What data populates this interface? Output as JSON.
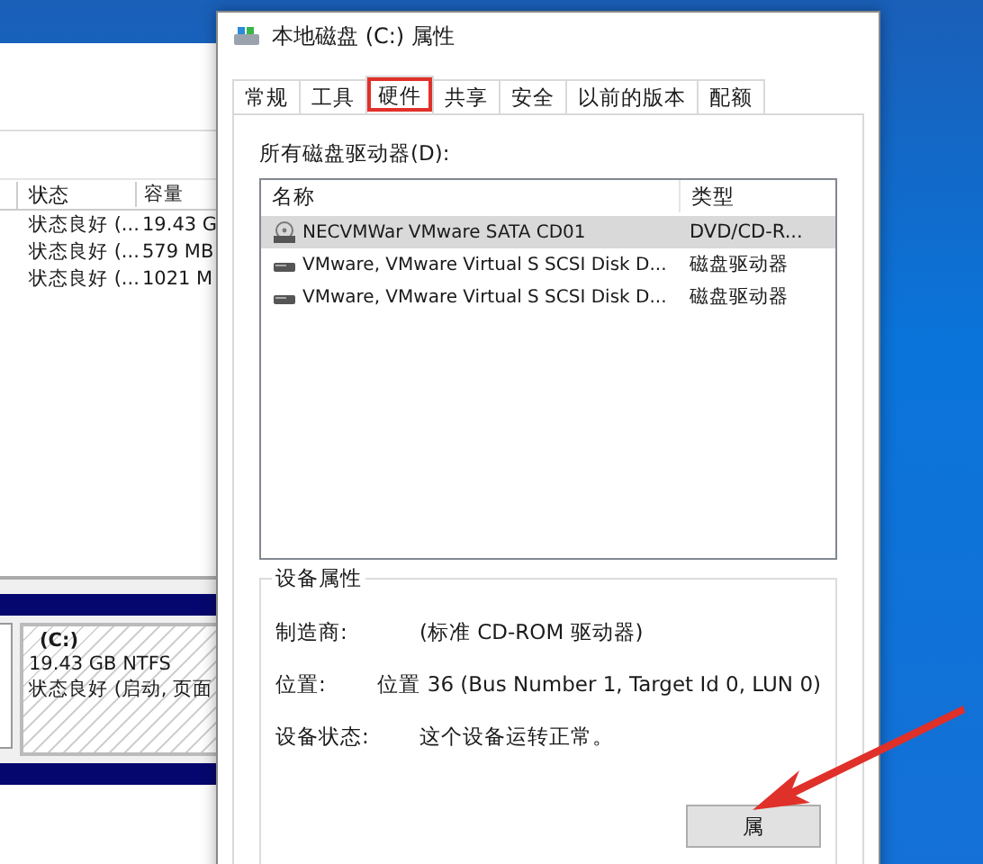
{
  "background_window": {
    "columns": [
      "状态",
      "容量"
    ],
    "rows": [
      [
        "状态良好 (...",
        "19.43 G"
      ],
      [
        "状态良好 (...",
        "579 MB"
      ],
      [
        "状态良好 (...",
        "1021 M"
      ]
    ],
    "partition": {
      "name": "(C:)",
      "size": "19.43 GB NTFS",
      "status": "状态良好 (启动, 页面"
    }
  },
  "dialog": {
    "title": "本地磁盘 (C:) 属性",
    "tabs": [
      {
        "label": "常规",
        "selected": false,
        "highlighted": false
      },
      {
        "label": "工具",
        "selected": false,
        "highlighted": false
      },
      {
        "label": "硬件",
        "selected": true,
        "highlighted": true
      },
      {
        "label": "共享",
        "selected": false,
        "highlighted": false
      },
      {
        "label": "安全",
        "selected": false,
        "highlighted": false
      },
      {
        "label": "以前的版本",
        "selected": false,
        "highlighted": false
      },
      {
        "label": "配额",
        "selected": false,
        "highlighted": false
      }
    ],
    "drives_label": "所有磁盘驱动器(D):",
    "columns": [
      "名称",
      "类型"
    ],
    "drives": [
      {
        "kind": "optical",
        "name": "NECVMWar VMware SATA CD01",
        "type": "DVD/CD-R...",
        "selected": true
      },
      {
        "kind": "disk",
        "name": "VMware, VMware Virtual S SCSI Disk D...",
        "type": "磁盘驱动器",
        "selected": false
      },
      {
        "kind": "disk",
        "name": "VMware, VMware Virtual S SCSI Disk D...",
        "type": "磁盘驱动器",
        "selected": false
      }
    ],
    "properties": {
      "title": "设备属性",
      "rows": [
        {
          "label": "制造商:",
          "value": "(标准 CD-ROM 驱动器)"
        },
        {
          "label": "位置:",
          "value": "位置 36 (Bus Number 1, Target Id 0, LUN 0)"
        },
        {
          "label": "设备状态:",
          "value": "这个设备运转正常。"
        }
      ]
    },
    "buttons": [
      "属"
    ]
  }
}
